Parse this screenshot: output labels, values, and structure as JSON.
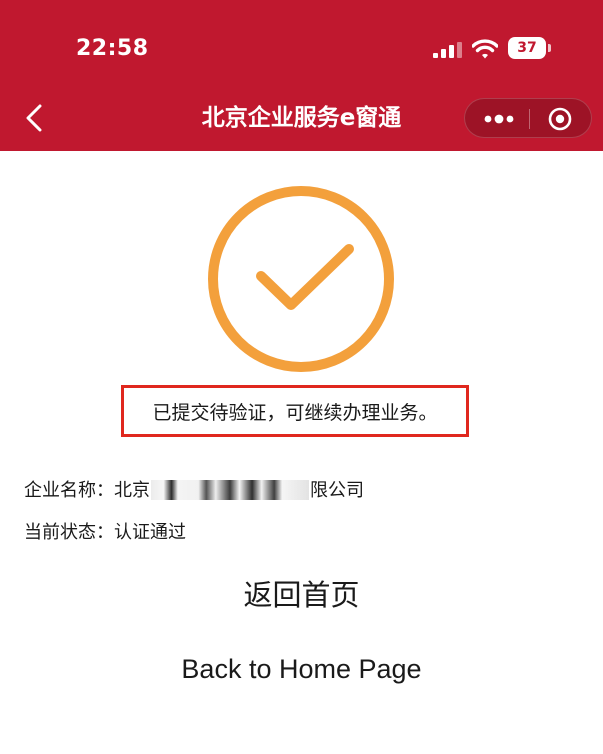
{
  "status_bar": {
    "time": "22:58",
    "battery": "37"
  },
  "nav": {
    "title": "北京企业服务e窗通"
  },
  "result": {
    "message": "已提交待验证，可继续办理业务。"
  },
  "info": {
    "company_label": "企业名称：",
    "company_prefix": "北京",
    "company_suffix": "限公司",
    "status_label": "当前状态：",
    "status_value": "认证通过"
  },
  "actions": {
    "home_cn": "返回首页",
    "home_en": "Back to Home Page"
  },
  "colors": {
    "header": "#c0182f",
    "success_icon": "#f3a03c",
    "highlight_border": "#e0281e"
  },
  "icons": [
    "back-arrow-icon",
    "signal-icon",
    "wifi-icon",
    "battery-icon",
    "more-dots-icon",
    "close-circle-icon",
    "check-circle-icon"
  ]
}
